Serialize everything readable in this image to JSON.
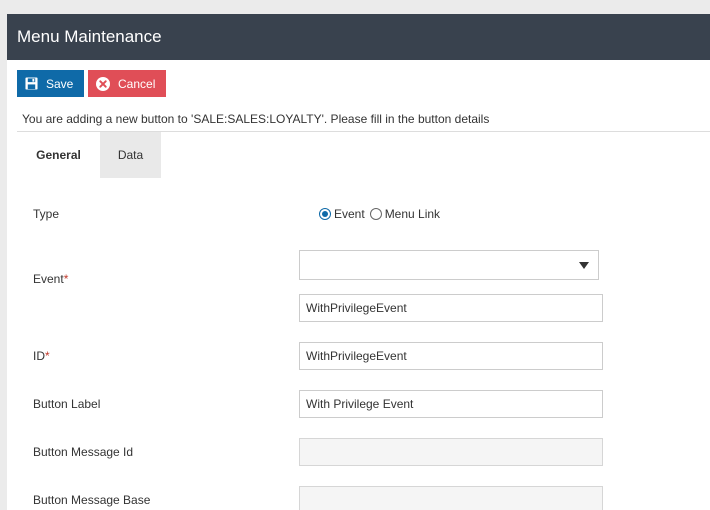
{
  "window": {
    "title": "Menu Maintenance"
  },
  "toolbar": {
    "save_label": "Save",
    "cancel_label": "Cancel"
  },
  "info_message": "You are adding a new button to 'SALE:SALES:LOYALTY'. Please fill in the button details",
  "tabs": [
    {
      "label": "General",
      "active": true
    },
    {
      "label": "Data",
      "active": false
    }
  ],
  "form": {
    "type": {
      "label": "Type",
      "options": [
        {
          "label": "Event",
          "selected": true
        },
        {
          "label": "Menu Link",
          "selected": false
        }
      ]
    },
    "event": {
      "label": "Event",
      "required_mark": "*",
      "select_value": "",
      "value": "WithPrivilegeEvent"
    },
    "id": {
      "label": "ID",
      "required_mark": "*",
      "value": "WithPrivilegeEvent"
    },
    "button_label": {
      "label": "Button Label",
      "value": "With Privilege Event"
    },
    "button_message_id": {
      "label": "Button Message Id",
      "value": ""
    },
    "button_message_base": {
      "label": "Button Message Base",
      "value": ""
    }
  },
  "colors": {
    "header_bg": "#39424e",
    "save_bg": "#0f6aa8",
    "cancel_bg": "#e04e57",
    "required": "#c0392b"
  }
}
